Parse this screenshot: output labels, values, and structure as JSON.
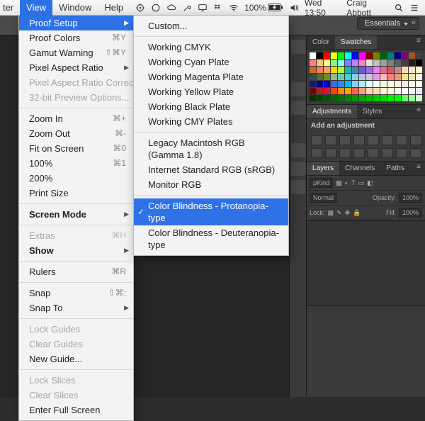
{
  "menubar": {
    "left": [
      "ter",
      "View",
      "Window",
      "Help"
    ],
    "selectedIndex": 1,
    "battery": "100%",
    "clock": "Wed 13:50",
    "user": "Craig Abbott"
  },
  "viewMenu": {
    "groups": [
      [
        {
          "label": "Proof Setup",
          "shortcut": "",
          "submenu": true,
          "selected": true
        },
        {
          "label": "Proof Colors",
          "shortcut": "⌘Y"
        },
        {
          "label": "Gamut Warning",
          "shortcut": "⇧⌘Y"
        },
        {
          "label": "Pixel Aspect Ratio",
          "submenu": true
        },
        {
          "label": "Pixel Aspect Ratio Correction",
          "disabled": true
        },
        {
          "label": "32-bit Preview Options...",
          "disabled": true
        }
      ],
      [
        {
          "label": "Zoom In",
          "shortcut": "⌘+"
        },
        {
          "label": "Zoom Out",
          "shortcut": "⌘-"
        },
        {
          "label": "Fit on Screen",
          "shortcut": "⌘0"
        },
        {
          "label": "100%",
          "shortcut": "⌘1"
        },
        {
          "label": "200%"
        },
        {
          "label": "Print Size"
        }
      ],
      [
        {
          "label": "Screen Mode",
          "submenu": true,
          "bold": true
        }
      ],
      [
        {
          "label": "Extras",
          "shortcut": "⌘H",
          "disabled": true
        },
        {
          "label": "Show",
          "submenu": true,
          "bold": true
        }
      ],
      [
        {
          "label": "Rulers",
          "shortcut": "⌘R"
        }
      ],
      [
        {
          "label": "Snap",
          "shortcut": "⇧⌘;"
        },
        {
          "label": "Snap To",
          "submenu": true
        }
      ],
      [
        {
          "label": "Lock Guides",
          "disabled": true
        },
        {
          "label": "Clear Guides",
          "disabled": true
        },
        {
          "label": "New Guide..."
        }
      ],
      [
        {
          "label": "Lock Slices",
          "disabled": true
        },
        {
          "label": "Clear Slices",
          "disabled": true
        },
        {
          "label": "Enter Full Screen"
        }
      ]
    ]
  },
  "proofSubmenu": {
    "groups": [
      [
        {
          "label": "Custom..."
        }
      ],
      [
        {
          "label": "Working CMYK"
        },
        {
          "label": "Working Cyan Plate"
        },
        {
          "label": "Working Magenta Plate"
        },
        {
          "label": "Working Yellow Plate"
        },
        {
          "label": "Working Black Plate"
        },
        {
          "label": "Working CMY Plates"
        }
      ],
      [
        {
          "label": "Legacy Macintosh RGB (Gamma 1.8)"
        },
        {
          "label": "Internet Standard RGB (sRGB)"
        },
        {
          "label": "Monitor RGB"
        }
      ],
      [
        {
          "label": "Color Blindness - Protanopia-type",
          "checked": true,
          "selected": true
        },
        {
          "label": "Color Blindness - Deuteranopia-type"
        }
      ]
    ]
  },
  "workspace": {
    "selected": "Essentials"
  },
  "panels": {
    "colorTabs": [
      "Color",
      "Swatches"
    ],
    "colorActive": 1,
    "adjTabs": [
      "Adjustments",
      "Styles"
    ],
    "adjActive": 0,
    "adjHeader": "Add an adjustment",
    "layerTabs": [
      "Layers",
      "Channels",
      "Paths"
    ],
    "layerActive": 0,
    "layerFilterLabel": "ρKind",
    "blendMode": "Normal",
    "opacityLabel": "Opacity:",
    "opacityValue": "100%",
    "lockLabel": "Lock:",
    "fillLabel": "Fill:",
    "fillValue": "100%"
  },
  "swatchColors": [
    "#ffffff",
    "#000000",
    "#ff0000",
    "#ffff00",
    "#00ff00",
    "#00ffff",
    "#0000ff",
    "#ff00ff",
    "#8b0000",
    "#808000",
    "#006400",
    "#008080",
    "#000080",
    "#800080",
    "#a0522d",
    "#404040",
    "#ff8080",
    "#ffc080",
    "#ffff80",
    "#80ff80",
    "#80ffff",
    "#8080ff",
    "#c080ff",
    "#ff80c0",
    "#e0e0e0",
    "#c0c0c0",
    "#a0a0a0",
    "#808080",
    "#606060",
    "#404040",
    "#202020",
    "#000000",
    "#d2691e",
    "#ff7f50",
    "#f4a460",
    "#ffd700",
    "#adff2f",
    "#20b2aa",
    "#4682b4",
    "#6a5acd",
    "#9370db",
    "#ee82ee",
    "#db7093",
    "#cd5c5c",
    "#bc8f8f",
    "#f5deb3",
    "#ffe4c4",
    "#fffacd",
    "#2f4f4f",
    "#556b2f",
    "#6b8e23",
    "#8fbc8f",
    "#66cdaa",
    "#48d1cc",
    "#87ceeb",
    "#b0c4de",
    "#d8bfd8",
    "#dda0dd",
    "#ffb6c1",
    "#fa8072",
    "#e9967a",
    "#f0e68c",
    "#eee8aa",
    "#faf0e6",
    "#191970",
    "#00008b",
    "#0000cd",
    "#4169e1",
    "#1e90ff",
    "#00bfff",
    "#87cefa",
    "#afeeee",
    "#e0ffff",
    "#f0ffff",
    "#f5f5dc",
    "#fff8dc",
    "#ffefd5",
    "#ffe4e1",
    "#fdf5e6",
    "#fffff0",
    "#800000",
    "#b22222",
    "#dc143c",
    "#ff4500",
    "#ff8c00",
    "#ffa500",
    "#ff6347",
    "#ffa07a",
    "#ffdab9",
    "#ffdead",
    "#fafad2",
    "#fffacd",
    "#f0fff0",
    "#f5fffa",
    "#f0f8ff",
    "#e6e6fa",
    "#003300",
    "#004400",
    "#005500",
    "#006600",
    "#007700",
    "#008800",
    "#009900",
    "#00aa00",
    "#00bb00",
    "#00cc00",
    "#00dd00",
    "#00ee00",
    "#00ff00",
    "#66ff66",
    "#99ff99",
    "#ccffcc"
  ]
}
